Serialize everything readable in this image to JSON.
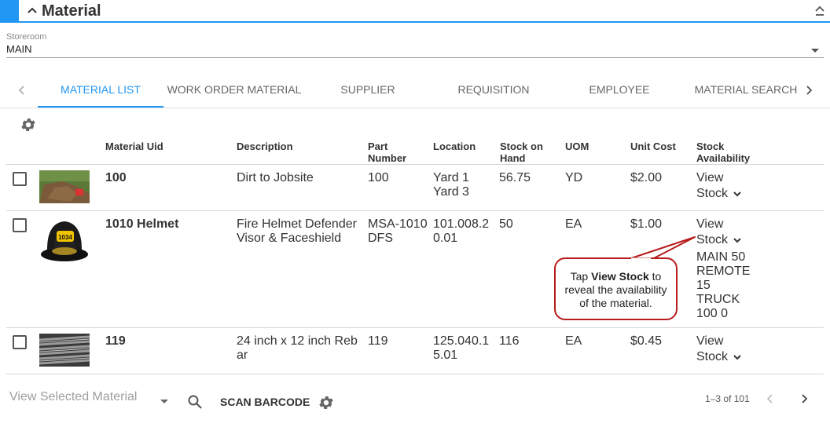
{
  "header": {
    "title": "Material"
  },
  "storeroom": {
    "label": "Storeroom",
    "value": "MAIN"
  },
  "tabs": [
    {
      "label": "MATERIAL LIST",
      "active": true
    },
    {
      "label": "WORK ORDER MATERIAL"
    },
    {
      "label": "SUPPLIER"
    },
    {
      "label": "REQUISITION"
    },
    {
      "label": "EMPLOYEE"
    },
    {
      "label": "MATERIAL SEARCH"
    }
  ],
  "table": {
    "headers": {
      "uid": "Material Uid",
      "description": "Description",
      "part_1": "Part",
      "part_2": "Number",
      "location": "Location",
      "stock_1": "Stock on",
      "stock_2": "Hand",
      "uom": "UOM",
      "cost": "Unit Cost",
      "avail_1": "Stock",
      "avail_2": "Availability"
    },
    "rows": [
      {
        "uid": "100",
        "description_1": "Dirt to Jobsite",
        "description_2": "",
        "part_1": "100",
        "part_2": "",
        "location_1": "Yard 1",
        "location_2": "Yard 3",
        "stock": "56.75",
        "uom": "YD",
        "cost": "$2.00",
        "view_1": "View",
        "view_2": "Stock",
        "avail": []
      },
      {
        "uid": "1010 Helmet",
        "description_1": "Fire Helmet Defender",
        "description_2": "Visor & Faceshield",
        "part_1": "MSA-1010",
        "part_2": "DFS",
        "location_1": "101.008.2",
        "location_2": "0.01",
        "stock": "50",
        "uom": "EA",
        "cost": "$1.00",
        "view_1": "View",
        "view_2": "Stock",
        "avail": [
          "MAIN 50",
          "REMOTE",
          "15",
          "TRUCK",
          "100 0"
        ]
      },
      {
        "uid": "119",
        "description_1": "24 inch x 12 inch Reb",
        "description_2": "ar",
        "part_1": "119",
        "part_2": "",
        "location_1": "125.040.1",
        "location_2": "5.01",
        "stock": "116",
        "uom": "EA",
        "cost": "$0.45",
        "view_1": "View",
        "view_2": "Stock",
        "avail": []
      }
    ]
  },
  "callout": {
    "prefix": "Tap ",
    "bold": "View Stock",
    "suffix": " to",
    "line_2": "reveal the availability",
    "line_3": "of the material."
  },
  "footer": {
    "select_placeholder": "View Selected Material",
    "scan_label": "SCAN BARCODE",
    "pagination": "1–3 of 101"
  },
  "colors": {
    "accent": "#2196f3",
    "callout_border": "#b71c1c"
  },
  "icons": [
    "chevron-up-icon",
    "collapse-icon",
    "gear-icon",
    "search-icon",
    "chevron-left-icon",
    "chevron-right-icon",
    "chevron-down-icon"
  ]
}
